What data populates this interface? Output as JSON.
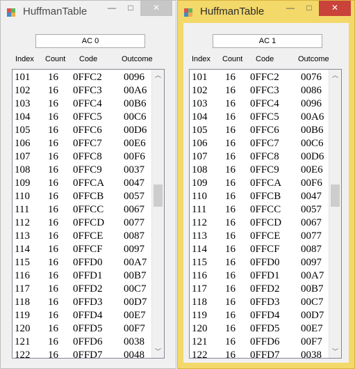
{
  "windows": [
    {
      "title": "HuffmanTable",
      "ac_label": "AC 0",
      "headers": {
        "index": "Index",
        "count": "Count",
        "code": "Code",
        "outcome": "Outcome"
      },
      "rows": [
        {
          "index": "101",
          "count": "16",
          "code": "0FFC2",
          "outcome": "0096"
        },
        {
          "index": "102",
          "count": "16",
          "code": "0FFC3",
          "outcome": "00A6"
        },
        {
          "index": "103",
          "count": "16",
          "code": "0FFC4",
          "outcome": "00B6"
        },
        {
          "index": "104",
          "count": "16",
          "code": "0FFC5",
          "outcome": "00C6"
        },
        {
          "index": "105",
          "count": "16",
          "code": "0FFC6",
          "outcome": "00D6"
        },
        {
          "index": "106",
          "count": "16",
          "code": "0FFC7",
          "outcome": "00E6"
        },
        {
          "index": "107",
          "count": "16",
          "code": "0FFC8",
          "outcome": "00F6"
        },
        {
          "index": "108",
          "count": "16",
          "code": "0FFC9",
          "outcome": "0037"
        },
        {
          "index": "109",
          "count": "16",
          "code": "0FFCA",
          "outcome": "0047"
        },
        {
          "index": "110",
          "count": "16",
          "code": "0FFCB",
          "outcome": "0057"
        },
        {
          "index": "111",
          "count": "16",
          "code": "0FFCC",
          "outcome": "0067"
        },
        {
          "index": "112",
          "count": "16",
          "code": "0FFCD",
          "outcome": "0077"
        },
        {
          "index": "113",
          "count": "16",
          "code": "0FFCE",
          "outcome": "0087"
        },
        {
          "index": "114",
          "count": "16",
          "code": "0FFCF",
          "outcome": "0097"
        },
        {
          "index": "115",
          "count": "16",
          "code": "0FFD0",
          "outcome": "00A7"
        },
        {
          "index": "116",
          "count": "16",
          "code": "0FFD1",
          "outcome": "00B7"
        },
        {
          "index": "117",
          "count": "16",
          "code": "0FFD2",
          "outcome": "00C7"
        },
        {
          "index": "118",
          "count": "16",
          "code": "0FFD3",
          "outcome": "00D7"
        },
        {
          "index": "119",
          "count": "16",
          "code": "0FFD4",
          "outcome": "00E7"
        },
        {
          "index": "120",
          "count": "16",
          "code": "0FFD5",
          "outcome": "00F7"
        },
        {
          "index": "121",
          "count": "16",
          "code": "0FFD6",
          "outcome": "0038"
        },
        {
          "index": "122",
          "count": "16",
          "code": "0FFD7",
          "outcome": "0048"
        }
      ]
    },
    {
      "title": "HuffmanTable",
      "ac_label": "AC 1",
      "headers": {
        "index": "Index",
        "count": "Count",
        "code": "Code",
        "outcome": "Outcome"
      },
      "rows": [
        {
          "index": "101",
          "count": "16",
          "code": "0FFC2",
          "outcome": "0076"
        },
        {
          "index": "102",
          "count": "16",
          "code": "0FFC3",
          "outcome": "0086"
        },
        {
          "index": "103",
          "count": "16",
          "code": "0FFC4",
          "outcome": "0096"
        },
        {
          "index": "104",
          "count": "16",
          "code": "0FFC5",
          "outcome": "00A6"
        },
        {
          "index": "105",
          "count": "16",
          "code": "0FFC6",
          "outcome": "00B6"
        },
        {
          "index": "106",
          "count": "16",
          "code": "0FFC7",
          "outcome": "00C6"
        },
        {
          "index": "107",
          "count": "16",
          "code": "0FFC8",
          "outcome": "00D6"
        },
        {
          "index": "108",
          "count": "16",
          "code": "0FFC9",
          "outcome": "00E6"
        },
        {
          "index": "109",
          "count": "16",
          "code": "0FFCA",
          "outcome": "00F6"
        },
        {
          "index": "110",
          "count": "16",
          "code": "0FFCB",
          "outcome": "0047"
        },
        {
          "index": "111",
          "count": "16",
          "code": "0FFCC",
          "outcome": "0057"
        },
        {
          "index": "112",
          "count": "16",
          "code": "0FFCD",
          "outcome": "0067"
        },
        {
          "index": "113",
          "count": "16",
          "code": "0FFCE",
          "outcome": "0077"
        },
        {
          "index": "114",
          "count": "16",
          "code": "0FFCF",
          "outcome": "0087"
        },
        {
          "index": "115",
          "count": "16",
          "code": "0FFD0",
          "outcome": "0097"
        },
        {
          "index": "116",
          "count": "16",
          "code": "0FFD1",
          "outcome": "00A7"
        },
        {
          "index": "117",
          "count": "16",
          "code": "0FFD2",
          "outcome": "00B7"
        },
        {
          "index": "118",
          "count": "16",
          "code": "0FFD3",
          "outcome": "00C7"
        },
        {
          "index": "119",
          "count": "16",
          "code": "0FFD4",
          "outcome": "00D7"
        },
        {
          "index": "120",
          "count": "16",
          "code": "0FFD5",
          "outcome": "00E7"
        },
        {
          "index": "121",
          "count": "16",
          "code": "0FFD6",
          "outcome": "00F7"
        },
        {
          "index": "122",
          "count": "16",
          "code": "0FFD7",
          "outcome": "0038"
        }
      ]
    }
  ],
  "icons": {
    "app": "huffman-app-icon",
    "minimize": "minimize-icon",
    "maximize": "maximize-icon",
    "close": "close-icon",
    "scroll_up": "chevron-up-icon",
    "scroll_down": "chevron-down-icon"
  },
  "colors": {
    "active_frame": "#f3d86a",
    "inactive_frame": "#f0f0f0",
    "active_close": "#c9433a",
    "inactive_close": "#c7c7c7"
  }
}
